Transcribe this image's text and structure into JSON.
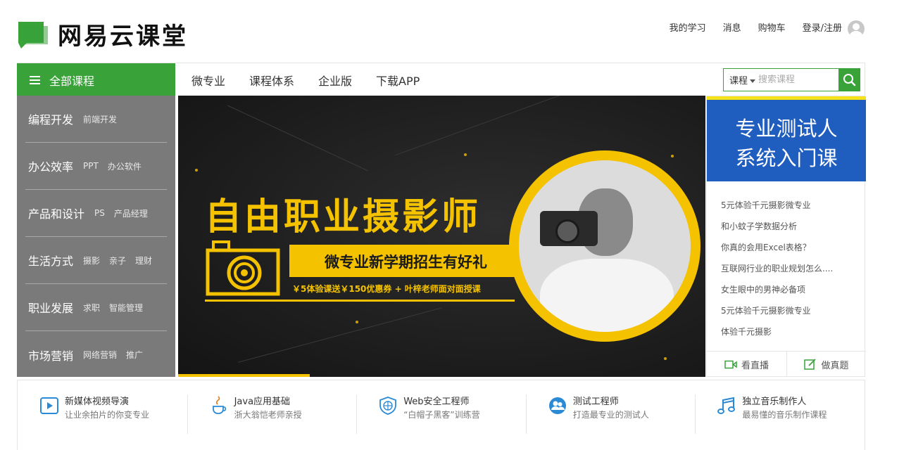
{
  "header": {
    "logo_text": "网易云课堂",
    "nav": [
      {
        "label": "我的学习"
      },
      {
        "label": "消息"
      },
      {
        "label": "购物车"
      },
      {
        "label": "登录/注册"
      }
    ]
  },
  "navbar": {
    "all_courses": "全部课程",
    "items": [
      {
        "label": "微专业"
      },
      {
        "label": "课程体系"
      },
      {
        "label": "企业版"
      },
      {
        "label": "下载APP"
      }
    ],
    "search": {
      "type_label": "课程",
      "placeholder": "搜索课程",
      "value": ""
    }
  },
  "sidebar": {
    "categories": [
      {
        "name": "编程开发",
        "subs": [
          "前端开发"
        ]
      },
      {
        "name": "办公效率",
        "subs": [
          "PPT",
          "办公软件"
        ]
      },
      {
        "name": "产品和设计",
        "subs": [
          "PS",
          "产品经理"
        ]
      },
      {
        "name": "生活方式",
        "subs": [
          "摄影",
          "亲子",
          "理财"
        ]
      },
      {
        "name": "职业发展",
        "subs": [
          "求职",
          "智能管理"
        ]
      },
      {
        "name": "市场营销",
        "subs": [
          "网络营销",
          "推广"
        ]
      }
    ]
  },
  "banner": {
    "title": "自由职业摄影师",
    "headline": "微专业新学期招生有好礼",
    "subline": "￥5体验课送￥150优惠券 + 叶梓老师面对面授课",
    "progress": 0.25,
    "accent_color": "#f5c200"
  },
  "right_panel": {
    "promo_line1": "专业测试人",
    "promo_line2": "系统入门课",
    "links": [
      {
        "label": "5元体验千元摄影微专业"
      },
      {
        "label": "和小蚊子学数据分析"
      },
      {
        "label": "你真的会用Excel表格？"
      },
      {
        "label": "互联网行业的职业规划怎么...."
      },
      {
        "label": "女生眼中的男神必备项"
      },
      {
        "label": "5元体验千元摄影微专业"
      },
      {
        "label": "体验千元摄影"
      }
    ],
    "live_label": "看直播",
    "quiz_label": "做真题"
  },
  "features": [
    {
      "title": "新媒体视频导演",
      "sub": "让业余拍片的你变专业",
      "icon": "video-play-icon"
    },
    {
      "title": "Java应用基础",
      "sub": "浙大翁恺老师亲授",
      "icon": "java-cup-icon"
    },
    {
      "title": "Web安全工程师",
      "sub": "“白帽子黑客”训练营",
      "icon": "shield-globe-icon"
    },
    {
      "title": "测试工程师",
      "sub": "打造最专业的测试人",
      "icon": "people-circle-icon"
    },
    {
      "title": "独立音乐制作人",
      "sub": "最易懂的音乐制作课程",
      "icon": "music-note-icon"
    }
  ],
  "colors": {
    "brand_green": "#39a33a",
    "sidebar_gray": "#7a7a7a",
    "promo_blue": "#1f5dbf"
  }
}
